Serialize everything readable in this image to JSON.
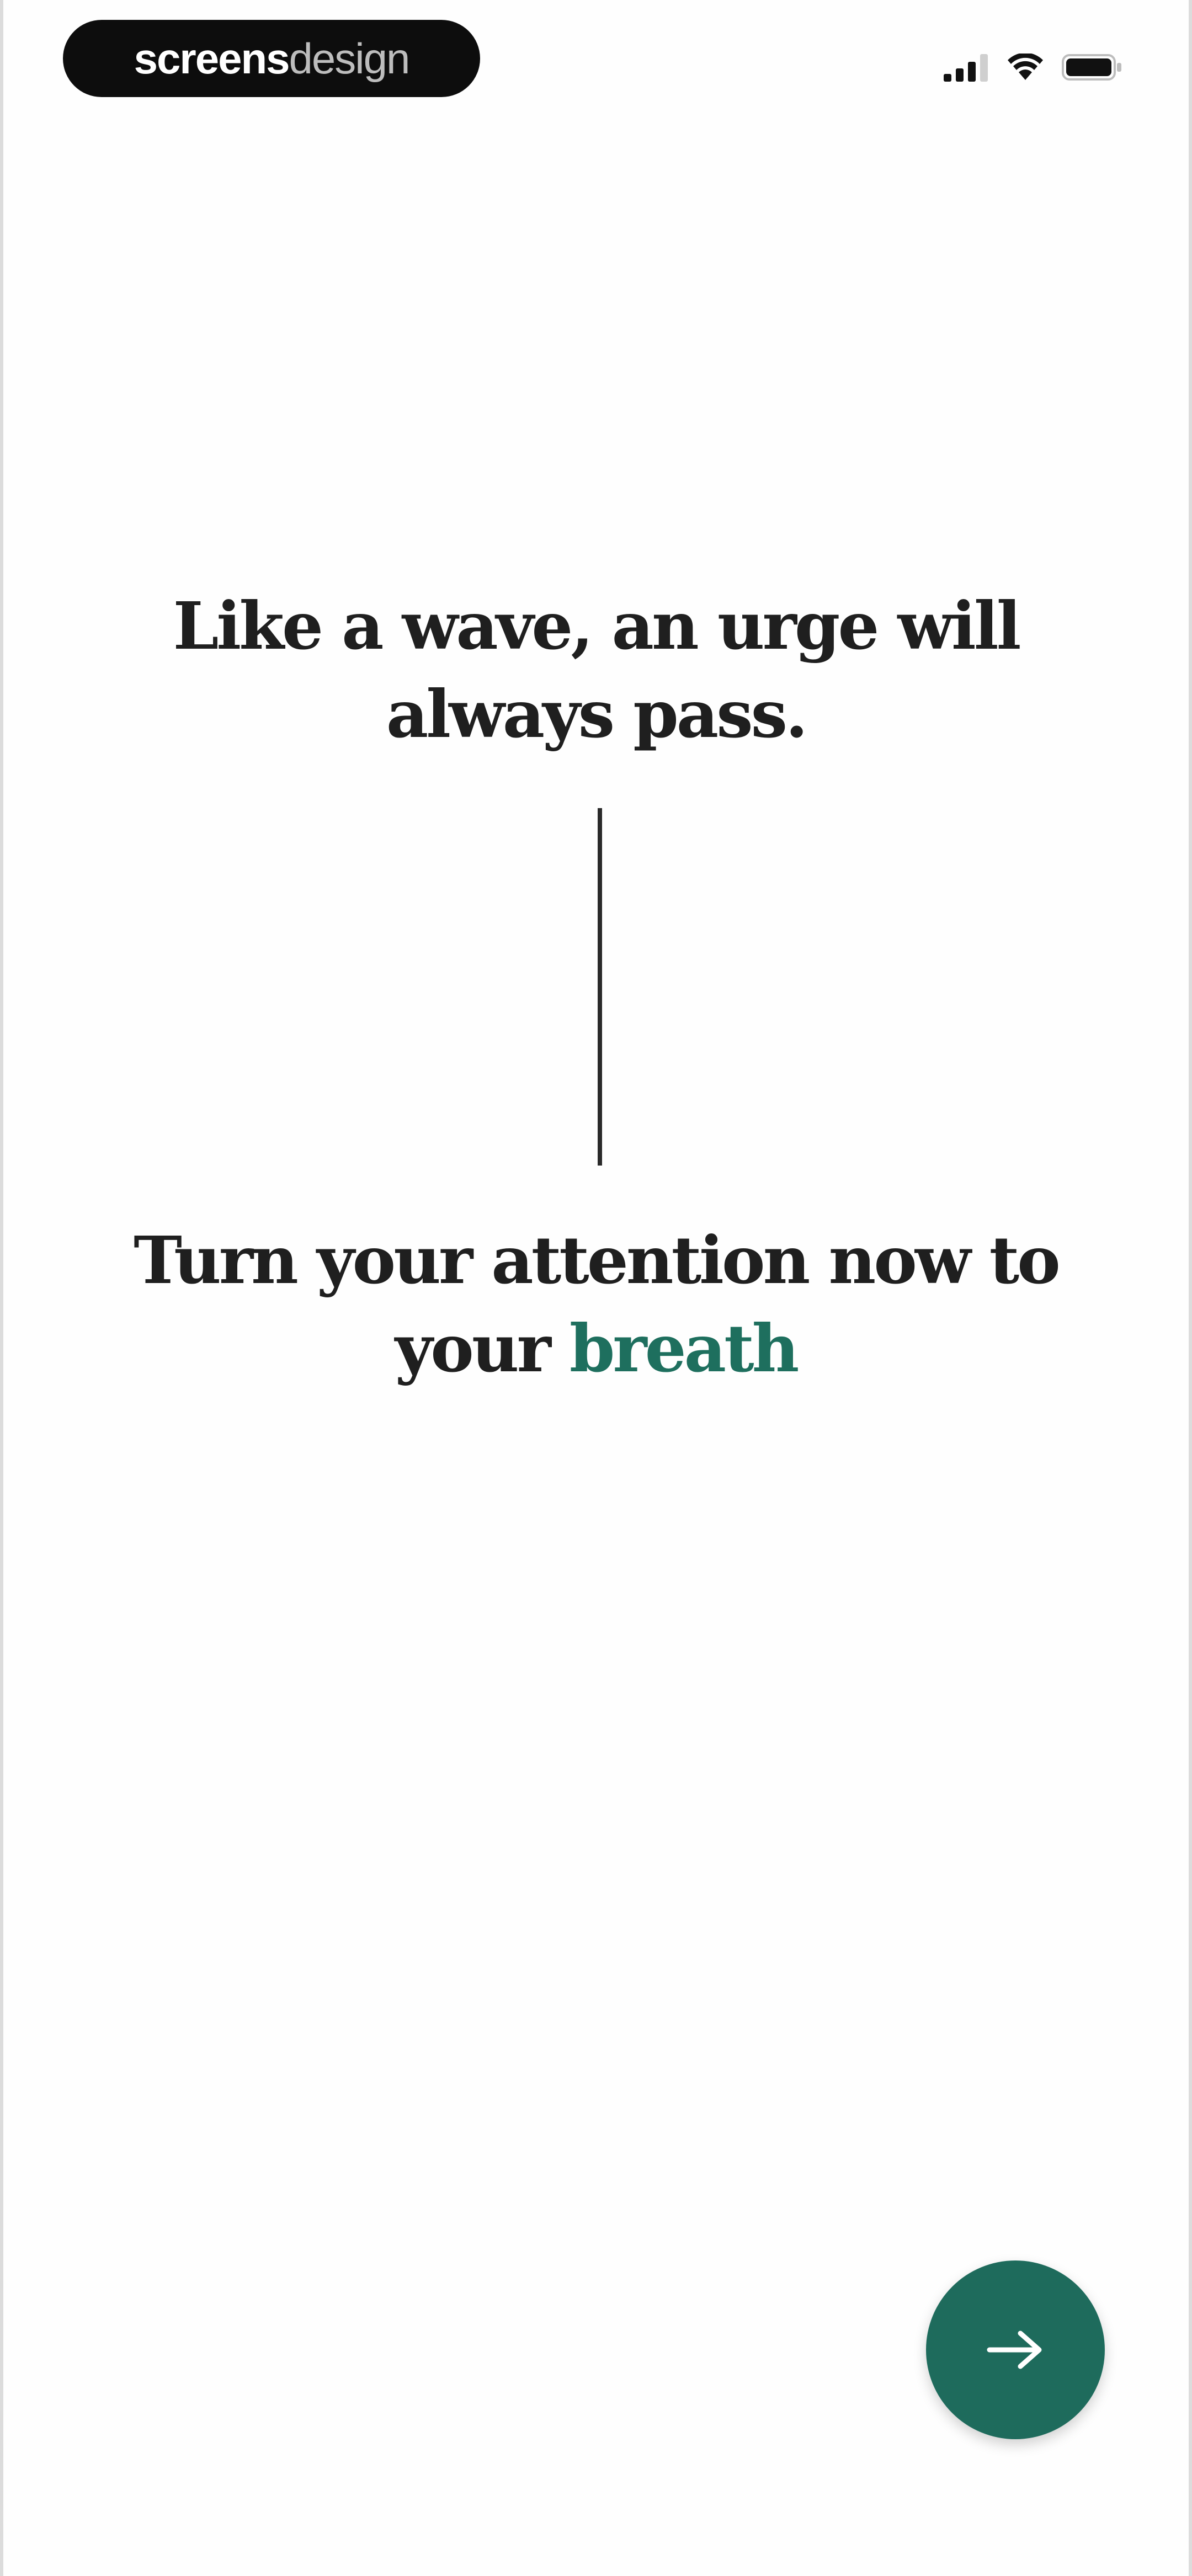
{
  "status_bar": {
    "brand_bold": "screens",
    "brand_light": "design",
    "signal_icon": "cellular-signal-icon",
    "wifi_icon": "wifi-icon",
    "battery_icon": "battery-icon"
  },
  "main": {
    "quote_top_line1": "Like a wave, an urge will",
    "quote_top_line2": "always pass.",
    "quote_bottom_line1": "Turn your attention now to",
    "quote_bottom_line2_prefix": "your ",
    "quote_bottom_line2_accent": "breath"
  },
  "next_button": {
    "icon": "arrow-right-icon"
  },
  "colors": {
    "accent": "#1e6f5e",
    "button": "#1e6b5c",
    "text": "#1f1f1f"
  }
}
